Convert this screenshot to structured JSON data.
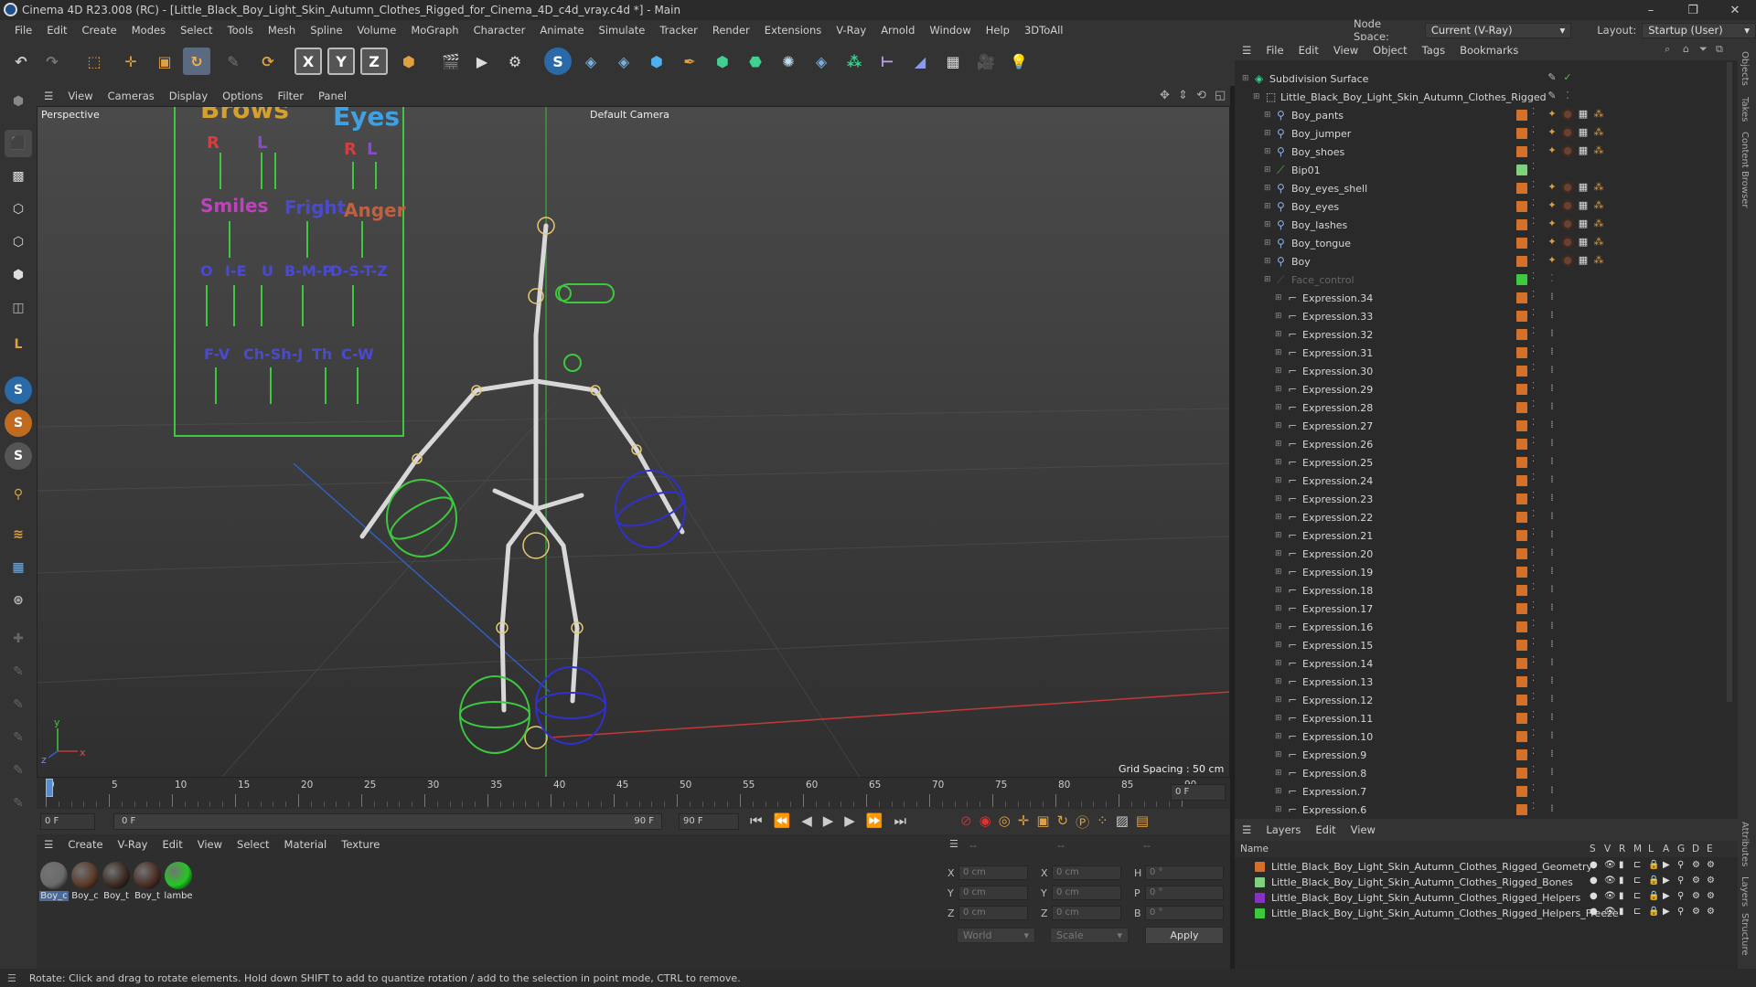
{
  "window": {
    "title": "Cinema 4D R23.008 (RC) - [Little_Black_Boy_Light_Skin_Autumn_Clothes_Rigged_for_Cinema_4D_c4d_vray.c4d *] - Main",
    "minimize": "–",
    "maximize": "❐",
    "close": "✕"
  },
  "menubar": {
    "items": [
      "File",
      "Edit",
      "Create",
      "Modes",
      "Select",
      "Tools",
      "Mesh",
      "Spline",
      "Volume",
      "MoGraph",
      "Character",
      "Animate",
      "Simulate",
      "Tracker",
      "Render",
      "Extensions",
      "V-Ray",
      "Arnold",
      "Window",
      "Help",
      "3DToAll"
    ],
    "node_space_label": "Node Space:",
    "node_space_value": "Current (V-Ray)",
    "layout_label": "Layout:",
    "layout_value": "Startup (User)"
  },
  "viewport": {
    "menu": [
      "View",
      "Cameras",
      "Display",
      "Options",
      "Filter",
      "Panel"
    ],
    "label": "Perspective",
    "camera": "Default Camera",
    "grid_spacing": "Grid Spacing : 50 cm",
    "axis_y": "y",
    "axis_z": "z",
    "axis_x": "x",
    "face_panel": {
      "brows": "Brows",
      "eyes": "Eyes",
      "r1": "R",
      "l1": "L",
      "r2": "R",
      "l2": "L",
      "smiles": "Smiles",
      "fright": "Fright",
      "anger": "Anger",
      "o": "O",
      "ie": "I-E",
      "u": "U",
      "bmp": "B-M-P",
      "dstz": "D-S-T-Z",
      "fv": "F-V",
      "chshj": "Ch-Sh-J",
      "th": "Th",
      "cw": "C-W"
    }
  },
  "timeline": {
    "ticks": [
      "0",
      "5",
      "10",
      "15",
      "20",
      "25",
      "30",
      "35",
      "40",
      "45",
      "50",
      "55",
      "60",
      "65",
      "70",
      "75",
      "80",
      "85",
      "90"
    ],
    "end_field": "0 F"
  },
  "transport": {
    "current_frame": "0 F",
    "range_start": "0 F",
    "range_end": "90 F",
    "max_frame": "90 F"
  },
  "materials": {
    "menu": [
      "Create",
      "V-Ray",
      "Edit",
      "View",
      "Select",
      "Material",
      "Texture"
    ],
    "items": [
      {
        "label": "Boy_c",
        "color": "#6a6a6a"
      },
      {
        "label": "Boy_c",
        "color": "#5a3a28"
      },
      {
        "label": "Boy_t",
        "color": "#3a2a22"
      },
      {
        "label": "Boy_t",
        "color": "#4a2e26"
      },
      {
        "label": "lambe",
        "color": "#22c822"
      }
    ]
  },
  "coords": {
    "header1": "--",
    "header2": "--",
    "header3": "--",
    "x": "X",
    "y": "Y",
    "z": "Z",
    "h": "H",
    "p": "P",
    "b": "B",
    "val_cm": "0 cm",
    "val_deg": "0 °",
    "world": "World",
    "scale": "Scale",
    "apply": "Apply"
  },
  "status": "Rotate: Click and drag to rotate elements. Hold down SHIFT to add to quantize rotation / add to the selection in point mode, CTRL to remove.",
  "objects": {
    "menu": [
      "File",
      "Edit",
      "View",
      "Object",
      "Tags",
      "Bookmarks"
    ],
    "root": "Subdivision Surface",
    "group": "Little_Black_Boy_Light_Skin_Autumn_Clothes_Rigged",
    "children": [
      "Boy_pants",
      "Boy_jumper",
      "Boy_shoes",
      "Bip01",
      "Boy_eyes_shell",
      "Boy_eyes",
      "Boy_lashes",
      "Boy_tongue",
      "Boy",
      "Face_control"
    ],
    "expressions": [
      "Expression.34",
      "Expression.33",
      "Expression.32",
      "Expression.31",
      "Expression.30",
      "Expression.29",
      "Expression.28",
      "Expression.27",
      "Expression.26",
      "Expression.25",
      "Expression.24",
      "Expression.23",
      "Expression.22",
      "Expression.21",
      "Expression.20",
      "Expression.19",
      "Expression.18",
      "Expression.17",
      "Expression.16",
      "Expression.15",
      "Expression.14",
      "Expression.13",
      "Expression.12",
      "Expression.11",
      "Expression.10",
      "Expression.9",
      "Expression.8",
      "Expression.7",
      "Expression.6"
    ]
  },
  "layers": {
    "menu": [
      "Layers",
      "Edit",
      "View"
    ],
    "name_header": "Name",
    "cols": [
      "S",
      "V",
      "R",
      "M",
      "L",
      "A",
      "G",
      "D",
      "E"
    ],
    "items": [
      {
        "name": "Little_Black_Boy_Light_Skin_Autumn_Clothes_Rigged_Geometry",
        "color": "#d4702a"
      },
      {
        "name": "Little_Black_Boy_Light_Skin_Autumn_Clothes_Rigged_Bones",
        "color": "#7fd17f"
      },
      {
        "name": "Little_Black_Boy_Light_Skin_Autumn_Clothes_Rigged_Helpers",
        "color": "#8a2fc8"
      },
      {
        "name": "Little_Black_Boy_Light_Skin_Autumn_Clothes_Rigged_Helpers_Freeze",
        "color": "#3ec83e"
      }
    ]
  },
  "side_tabs": [
    "Objects",
    "Takes",
    "Content Browser",
    "Attributes",
    "Layers",
    "Structure"
  ]
}
